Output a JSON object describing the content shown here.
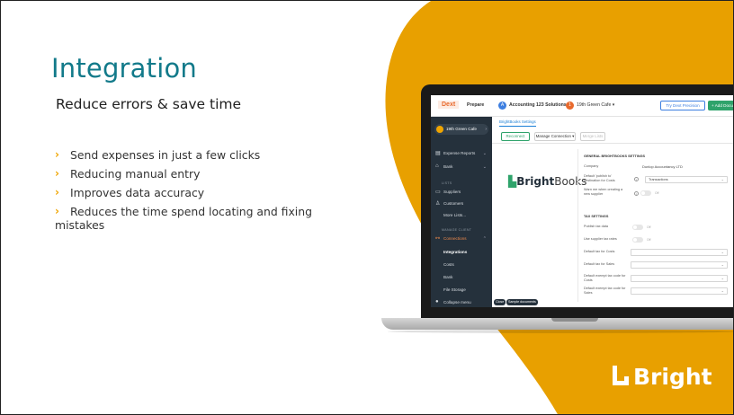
{
  "slide": {
    "title": "Integration",
    "subtitle": "Reduce errors & save time",
    "bullets": [
      "Send expenses in just a few clicks",
      "Reducing manual entry",
      "Improves data accuracy",
      "Reduces the time spend locating and fixing",
      "mistakes"
    ],
    "brand_name": "Bright",
    "colors": {
      "accent_orange": "#E8A000",
      "title_teal": "#127A8A",
      "bullet_marker": "#F0A500"
    }
  },
  "app": {
    "logo": "Dext",
    "mode": "Prepare",
    "practice_initial": "A",
    "practice": "Accounting 123 Solutions",
    "client_initial": "1",
    "client": "19th Green Cafe ▾",
    "try_button": "Try Dext Precision",
    "add_button": "+ Add Documents",
    "sidebar": {
      "client_pill": "19th Green Cafe",
      "items": [
        {
          "label": "Expense Reports",
          "icon": "document-icon"
        },
        {
          "label": "Bank",
          "icon": "bank-icon"
        }
      ],
      "lists_heading": "LISTS",
      "lists": [
        {
          "label": "Suppliers",
          "icon": "truck-icon"
        },
        {
          "label": "Customers",
          "icon": "people-icon"
        },
        {
          "label": "More Lists...",
          "icon": ""
        }
      ],
      "manage_heading": "MANAGE CLIENT",
      "connections": "Connections",
      "sub_items": [
        "Integrations",
        "Costs",
        "Bank",
        "File Storage"
      ],
      "collapse": "Collapse menu"
    },
    "tab": "BrightBooks Settings",
    "buttons": {
      "reconnect": "Reconnect",
      "manage": "Manage Connection ▾",
      "merge": "Merge Lists"
    },
    "integration_logo": {
      "brand": "Bright",
      "suffix": "Books"
    },
    "settings": {
      "general_heading": "GENERAL BRIGHTBOOKS SETTINGS",
      "company_label": "Company",
      "company_value": "Dunlop Accountancy LTD",
      "default_publish_label": "Default 'publish to' destination for Costs",
      "default_publish_value": "Transactions",
      "warn_label": "Warn me when creating a new supplier",
      "off": "Off",
      "tax_heading": "TAX SETTINGS",
      "publish_tax_label": "Publish tax data",
      "use_supplier_label": "Use supplier tax rates",
      "default_tax_costs": "Default tax for Costs",
      "default_tax_sales": "Default tax for Sales",
      "default_exempt_costs": "Default exempt tax code for Costs",
      "default_exempt_sales": "Default exempt tax code for Sales"
    },
    "bottom": {
      "close": "Close",
      "sample": "Sample documents"
    }
  }
}
